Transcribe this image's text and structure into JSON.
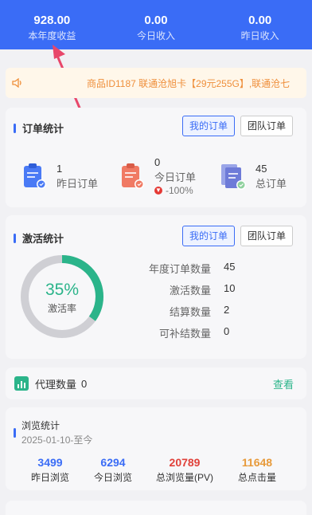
{
  "header": {
    "stats": [
      {
        "value": "928.00",
        "label": "本年度收益"
      },
      {
        "value": "0.00",
        "label": "今日收入"
      },
      {
        "value": "0.00",
        "label": "昨日收入"
      }
    ]
  },
  "notice": {
    "icon": "speaker-icon",
    "text": "商品ID1187 联通沧旭卡【29元255G】,联通沧七"
  },
  "orders": {
    "title": "订单统计",
    "tabs": [
      "我的订单",
      "团队订单"
    ],
    "items": [
      {
        "value": "1",
        "label": "昨日订单",
        "icon": "clipboard-icon",
        "color": "#4a7af5"
      },
      {
        "value": "0",
        "label": "今日订单",
        "change": "-100%",
        "icon": "clipboard-icon",
        "color": "#f07a64"
      },
      {
        "value": "45",
        "label": "总订单",
        "icon": "document-icon",
        "color": "#6e7bd8"
      }
    ]
  },
  "activation": {
    "title": "激活统计",
    "tabs": [
      "我的订单",
      "团队订单"
    ],
    "rate": "35%",
    "rate_fraction": 0.35,
    "rate_label": "激活率",
    "rows": [
      {
        "label": "年度订单数量",
        "value": "45"
      },
      {
        "label": "激活数量",
        "value": "10"
      },
      {
        "label": "结算数量",
        "value": "2"
      },
      {
        "label": "可补结数量",
        "value": "0"
      }
    ]
  },
  "agents": {
    "label": "代理数量",
    "count": "0",
    "view": "查看"
  },
  "browse": {
    "title": "浏览统计",
    "date": "2025-01-10-至今",
    "stats": [
      {
        "value": "3499",
        "label": "昨日浏览",
        "color": "#3a6cf6"
      },
      {
        "value": "6294",
        "label": "今日浏览",
        "color": "#3a6cf6"
      },
      {
        "value": "20789",
        "label": "总浏览量(PV)",
        "color": "#e0413a"
      },
      {
        "value": "11648",
        "label": "总点击量",
        "color": "#e79a3a"
      }
    ]
  },
  "colors": {
    "primary": "#3a6cf6",
    "accent_green": "#2bb48a",
    "arrow": "#e8476a"
  }
}
